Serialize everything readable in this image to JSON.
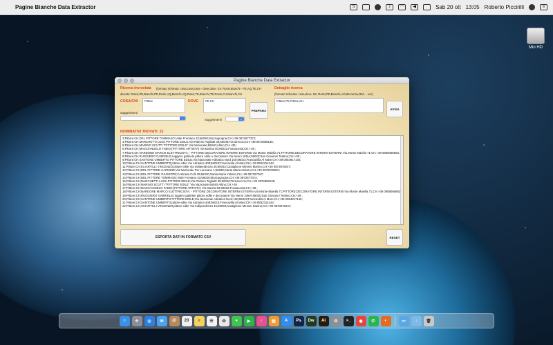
{
  "menubar": {
    "app_name": "Pagine Bianche Data Extractor",
    "date": "Sab 20 ott",
    "time": "13:05",
    "user": "Roberto Piccirilli"
  },
  "desktop": {
    "disk_label": "Mio HD"
  },
  "window": {
    "title": "Pagine Bianche Data Extractor",
    "ricerca_label": "Ricerca incrociata",
    "ricerca_hint": "(formato richiesta: cosa,cosa,cosa - dove,dove.  Es: Rossi,Bianchi - PE,AQ,TE,CH",
    "ricerca_example": "diventa: Rossi,PE,Bianchi,PE,Rossi,AQ,Bianchi,AQ,Rossi,TE,Bianchi,TE,Rossi,CH,Bianchi,CH",
    "dettaglio_label": "Dettaglio ricerca",
    "dettaglio_hint": "(formato richiesta: cosa,dove. Es: Rossi,PE,Bianchi,AV,Mercurino,RM.... ecc)",
    "cosa_label": "COSA/CHI",
    "cosa_value": "Pittore",
    "dove_label": "DOVE",
    "dove_value": "PE,CH",
    "prepara_label": "PREPARA",
    "dettaglio_value": "Pittore,PE,Pittore,CH",
    "avvia_label": "AVVIA",
    "suggerimenti_label": "Suggerimenti",
    "count_label": "NOMINATIVI TROVATI: 22",
    "export_label": "ESPORTA DATI IN FORMATO CSV",
    "reset_label": "RESET",
    "results": [
      "3;Pittore;CH;DEL PITTORE TOMMASO;Viale Frentano 33;66030;Mozzagrogna;CH;+39 0872577372;",
      "4;Pittore;CH;MARCHETTI LUIGI PITTORE EDILE;Via Palmiro Togliatti 39;66046;Tornareccio;CH;+39 0872868136;",
      "5;Pittore;CH;MARINO SCUTTI \"PITTORE EDILE\" Via Nazionale;66040;Altino;CH;+39 ;",
      "6;Pittore;CH;MASCIANGELO FABIO;(PITTORE ARTISTA) Via Marina 50;66022;Fossacesia;CH;+39 ;",
      "7;Pittore;CH;NARDONE MARCO ELETTRICISTA; - PITTORE DECORATORE INTERNI ESTERNI Via Monte Maiella 71;PITTORE;DECORATORE INTERNI ESTERNI Via Monte Maiella 71;CH;+39 0859066863;",
      "8;Pittore;CH;RUGGIERO GABRIELE;ruggiero gabriele pittore edile e decoratore Via Nenni 105/A;66020;San Giovanni Teatino;CH;+39 ;",
      "9;Pittore;CH;SANTONE UMBERTO PITTORE EDILE;Via Nazionale Adriatica Nord 150;66023;Francavilla Al Mare;CH;+39 0854917146;",
      "10;Pittore;CH;SANTONE UMBERTO;pittore edile Via Adriatica 408;66023;Francavilla Al Mare;CH;+39 0852314144;",
      "11;Pittore;CH;SCIARTILLI VINCENZO;pittore edile Via Indipendenza 45;66033;Castiglione Messer Marino;CH;+39 0873978247;",
      "12;Pittore;CH;DEL PITTORE CARMINE;Via Nazionale Per Lanciano 1;66030;Santa Maria Imbaro;CH;+39 0872578845;",
      "13;Pittore;CH;DEL PITTORE GIUSEPPE;Contrada Colli 29;66030;Santa Maria Imbaro;CH;+39 087257367;",
      "14;Pittore;CH;DEL PITTORE TOMMASO;Viale Frentano 33;66030;Mozzagrogna;CH;+39 0872577372;",
      "15;Pittore;CH;MARCHETTI LUIGI PITTORE EDILE;Via Palmiro Togliatti 39;66046;Tornareccio;CH;+39 0872868136;",
      "16;Pittore;CH;MARINO SCUTTI \"PITTORE EDILE\" Via Nazionale;66040;Altino;CH;+39 ;",
      "17;Pittore;CH;MASCIANGELO FABIO;(PITTORE ARTISTA) Via Marina 50;66022;Fossacesia;CH;+39 ;",
      "18;Pittore;CH;NARDONE MARCO ELETTRICISTA; - PITTORE DECORATORE INTERNI ESTERNI Via Monte Maiella 71;PITTORE;DECORATORE INTERNI ESTERNI Via Monte Maiella 71;CH;+39 0859066863;",
      "19;Pittore;CH;RUGGIERO GABRIELE;ruggiero gabriele pittore edile e decoratore Via Nenni 105/A;66020;San Giovanni Teatino;CH;+39 ;",
      "20;Pittore;CH;SANTONE UMBERTO PITTORE EDILE;Via Nazionale Adriatica Nord 150;66023;Francavilla Al Mare;CH;+39 0854917146;",
      "21;Pittore;CH;SANTONE UMBERTO;pittore edile Via Adriatica 408;66023;Francavilla Al Mare;CH;+39 0852314144;",
      "22;Pittore;CH;SCIARTILLI VINCENZO;pittore edile Via Indipendenza 45;66033;Castiglione Messer Marino;CH;+39 0873978247;"
    ]
  },
  "dock": {
    "icons": [
      {
        "name": "finder-icon",
        "color": "#3a8fe8",
        "glyph": "☺"
      },
      {
        "name": "launchpad-icon",
        "color": "#8a8f99",
        "glyph": "✈"
      },
      {
        "name": "safari-icon",
        "color": "#2d7fe0",
        "glyph": "◎"
      },
      {
        "name": "mail-icon",
        "color": "#4aa3f0",
        "glyph": "✉"
      },
      {
        "name": "contacts-icon",
        "color": "#b58a5c",
        "glyph": "@"
      },
      {
        "name": "calendar-icon",
        "color": "#f0f0f0",
        "glyph": "20"
      },
      {
        "name": "notes-icon",
        "color": "#f4d35e",
        "glyph": "≡"
      },
      {
        "name": "reminders-icon",
        "color": "#f3f3f3",
        "glyph": "☰"
      },
      {
        "name": "photos-icon",
        "color": "#e9e9e9",
        "glyph": "✿"
      },
      {
        "name": "messages-icon",
        "color": "#3fc54d",
        "glyph": "●"
      },
      {
        "name": "facetime-icon",
        "color": "#2fb34a",
        "glyph": "▶"
      },
      {
        "name": "itunes-icon",
        "color": "#e8508e",
        "glyph": "♪"
      },
      {
        "name": "ibooks-icon",
        "color": "#f29b33",
        "glyph": "▤"
      },
      {
        "name": "appstore-icon",
        "color": "#2f8ef0",
        "glyph": "A"
      },
      {
        "name": "photoshop-icon",
        "color": "#11254a",
        "glyph": "Ps"
      },
      {
        "name": "dreamweaver-icon",
        "color": "#1f3a1f",
        "glyph": "Dw"
      },
      {
        "name": "illustrator-icon",
        "color": "#2b1a05",
        "glyph": "Ai"
      },
      {
        "name": "preferences-icon",
        "color": "#8e8e93",
        "glyph": "⚙"
      },
      {
        "name": "terminal-icon",
        "color": "#222222",
        "glyph": ">_"
      },
      {
        "name": "chrome-icon",
        "color": "#e5463b",
        "glyph": "◉"
      },
      {
        "name": "whatsapp-icon",
        "color": "#29b44f",
        "glyph": "✆"
      },
      {
        "name": "firefox-icon",
        "color": "#e66a1f",
        "glyph": "◐"
      },
      {
        "name": "folder-icon",
        "color": "#5aa7e6",
        "glyph": "▭"
      },
      {
        "name": "downloads-icon",
        "color": "#7fb9ea",
        "glyph": "↓"
      },
      {
        "name": "trash-icon",
        "color": "#c9c9c9",
        "glyph": "🗑"
      }
    ]
  }
}
